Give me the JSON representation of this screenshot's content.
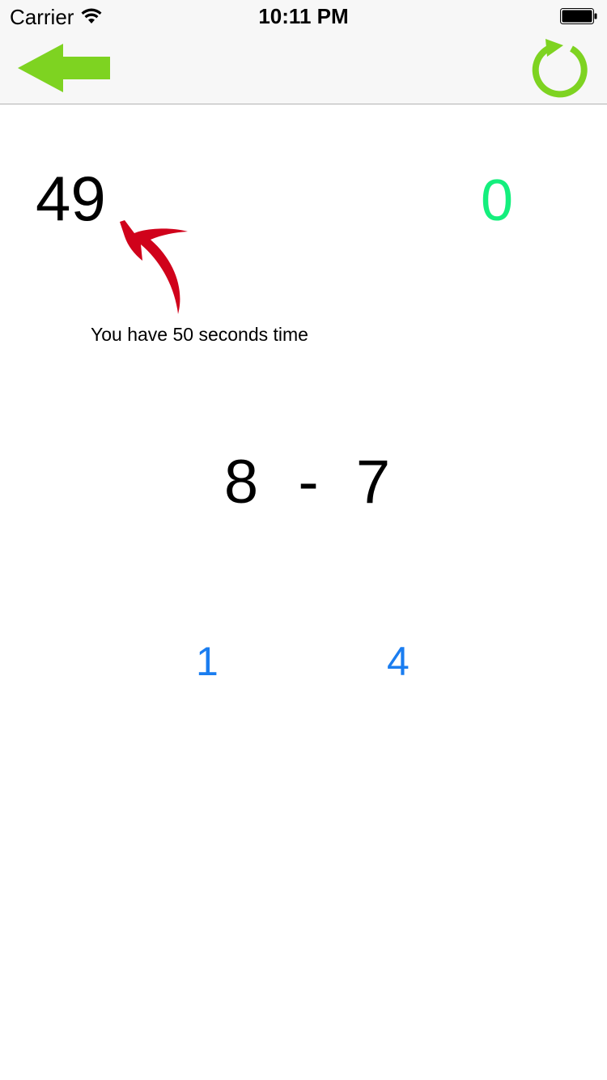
{
  "status_bar": {
    "carrier": "Carrier",
    "time": "10:11 PM",
    "wifi_icon": "wifi-icon",
    "battery_icon": "battery-icon"
  },
  "nav_bar": {
    "back_icon": "arrow-left-icon",
    "refresh_icon": "refresh-icon",
    "accent_color": "#7ed321"
  },
  "game": {
    "timer": "49",
    "score": "0",
    "score_color": "#14ef7d",
    "hint": "You have 50 seconds time",
    "hint_arrow_color": "#d0021b",
    "question": {
      "operand_1": "8",
      "operator": "-",
      "operand_2": "7"
    },
    "answers": [
      "1",
      "4"
    ],
    "answer_color": "#1a7df0"
  }
}
